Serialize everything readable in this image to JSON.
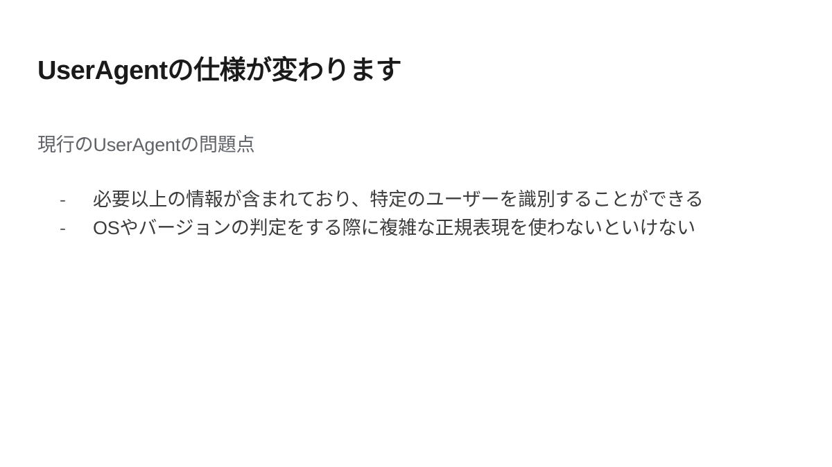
{
  "title": "UserAgentの仕様が変わります",
  "subtitle": "現行のUserAgentの問題点",
  "bullet_char": "-",
  "items": [
    "必要以上の情報が含まれており、特定のユーザーを識別することができる",
    "OSやバージョンの判定をする際に複雑な正規表現を使わないといけない"
  ]
}
